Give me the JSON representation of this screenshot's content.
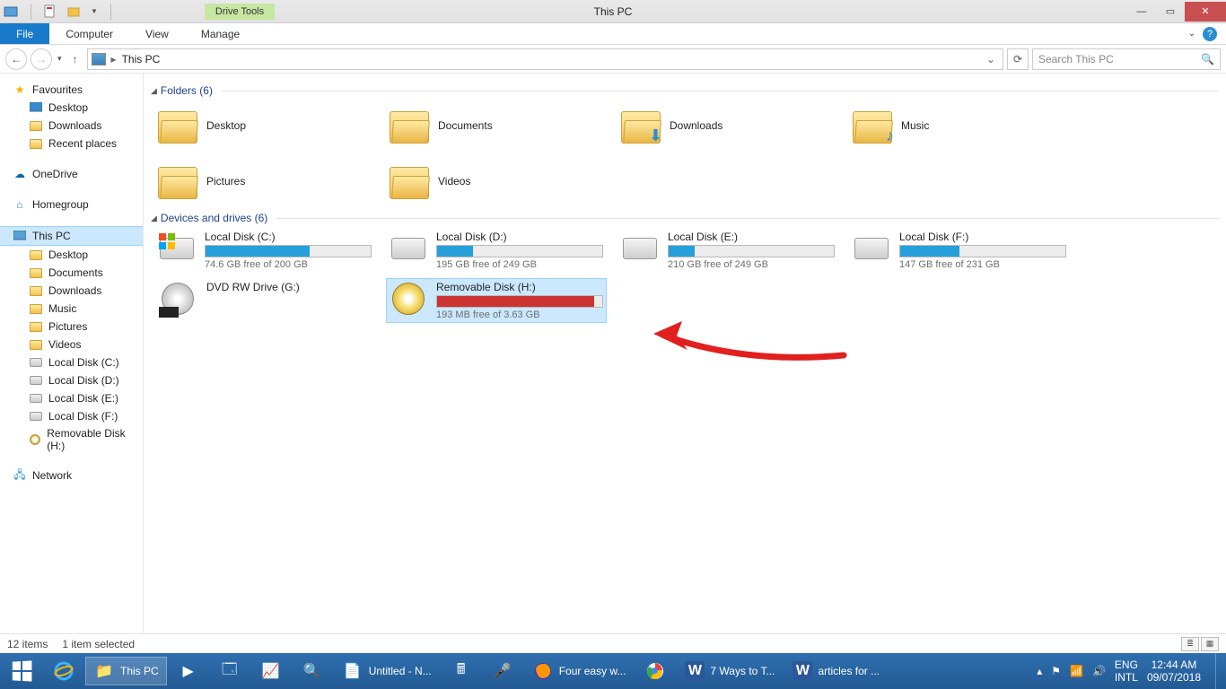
{
  "window": {
    "title": "This PC",
    "drive_tools": "Drive Tools"
  },
  "ribbon": {
    "file": "File",
    "computer": "Computer",
    "view": "View",
    "manage": "Manage"
  },
  "nav": {
    "crumb": "This PC",
    "search_placeholder": "Search This PC"
  },
  "sidebar": {
    "favourites": "Favourites",
    "fav_items": [
      "Desktop",
      "Downloads",
      "Recent places"
    ],
    "onedrive": "OneDrive",
    "homegroup": "Homegroup",
    "thispc": "This PC",
    "pc_items": [
      "Desktop",
      "Documents",
      "Downloads",
      "Music",
      "Pictures",
      "Videos",
      "Local Disk (C:)",
      "Local Disk (D:)",
      "Local Disk (E:)",
      "Local Disk (F:)",
      "Removable Disk (H:)"
    ],
    "network": "Network"
  },
  "sections": {
    "folders": "Folders (6)",
    "devices": "Devices and drives (6)"
  },
  "folders": [
    {
      "label": "Desktop",
      "overlay": ""
    },
    {
      "label": "Documents",
      "overlay": ""
    },
    {
      "label": "Downloads",
      "overlay": "⬇"
    },
    {
      "label": "Music",
      "overlay": "♪"
    },
    {
      "label": "Pictures",
      "overlay": ""
    },
    {
      "label": "Videos",
      "overlay": ""
    }
  ],
  "drives": [
    {
      "name": "Local Disk (C:)",
      "free": "74.6 GB free of 200 GB",
      "fill": 63,
      "color": "#26a0da",
      "type": "os"
    },
    {
      "name": "Local Disk (D:)",
      "free": "195 GB free of 249 GB",
      "fill": 22,
      "color": "#26a0da",
      "type": "hdd"
    },
    {
      "name": "Local Disk (E:)",
      "free": "210 GB free of 249 GB",
      "fill": 16,
      "color": "#26a0da",
      "type": "hdd"
    },
    {
      "name": "Local Disk (F:)",
      "free": "147 GB free of 231 GB",
      "fill": 36,
      "color": "#26a0da",
      "type": "hdd"
    },
    {
      "name": "DVD RW Drive (G:)",
      "free": "",
      "fill": 0,
      "color": "",
      "type": "dvd"
    },
    {
      "name": "Removable Disk (H:)",
      "free": "193 MB free of 3.63 GB",
      "fill": 95,
      "color": "#c33",
      "type": "usb",
      "selected": true
    }
  ],
  "status": {
    "items": "12 items",
    "selected": "1 item selected"
  },
  "taskbar": {
    "items": [
      {
        "label": "",
        "icon": "ie",
        "pinned": true
      },
      {
        "label": "This PC",
        "icon": "explorer",
        "active": true
      },
      {
        "label": "",
        "icon": "app1",
        "pinned": true
      },
      {
        "label": "",
        "icon": "app2",
        "pinned": true
      },
      {
        "label": "",
        "icon": "app3",
        "pinned": true
      },
      {
        "label": "",
        "icon": "app4",
        "pinned": true
      },
      {
        "label": "Untitled - N...",
        "icon": "notepad"
      },
      {
        "label": "",
        "icon": "calc",
        "pinned": true
      },
      {
        "label": "",
        "icon": "mic",
        "pinned": true
      },
      {
        "label": "Four easy w...",
        "icon": "firefox"
      },
      {
        "label": "",
        "icon": "chrome",
        "pinned": true
      },
      {
        "label": "7 Ways to T...",
        "icon": "word"
      },
      {
        "label": "articles for ...",
        "icon": "word"
      }
    ],
    "lang1": "ENG",
    "lang2": "INTL",
    "time": "12:44 AM",
    "date": "09/07/2018"
  }
}
